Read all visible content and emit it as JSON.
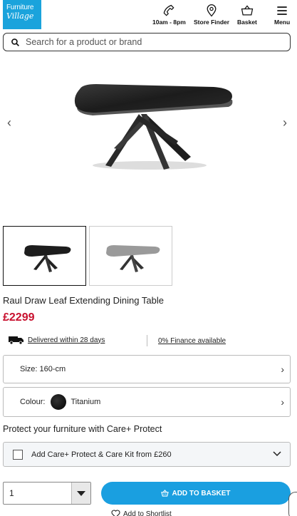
{
  "header": {
    "logo_line1": "Furniture",
    "logo_line2": "Village",
    "phone_label": "10am - 8pm",
    "store_label": "Store Finder",
    "basket_label": "Basket",
    "menu_label": "Menu"
  },
  "search": {
    "placeholder": "Search for a product or brand"
  },
  "gallery": {
    "prev_icon": "chevron-left-icon",
    "next_icon": "chevron-right-icon",
    "thumbnails": [
      "dark-table",
      "grey-table"
    ]
  },
  "product": {
    "title": "Raul Draw Leaf Extending Dining Table",
    "price": "£2299"
  },
  "info": {
    "delivery": "Delivered within 28 days",
    "finance": "0% Finance available"
  },
  "options": {
    "size": "Size: 160-cm",
    "colour_label": "Colour:",
    "colour_value": "Titanium"
  },
  "protect": {
    "heading": "Protect your furniture with Care+ Protect",
    "option": "Add Care+ Protect & Care Kit from £260"
  },
  "purchase": {
    "quantity": "1",
    "add_to_basket": "ADD TO BASKET",
    "shortlist": "Add to Shortlist"
  },
  "colors": {
    "brand_blue": "#1aa3dc",
    "button_blue": "#1a9fe0",
    "price_red": "#c8102e"
  }
}
